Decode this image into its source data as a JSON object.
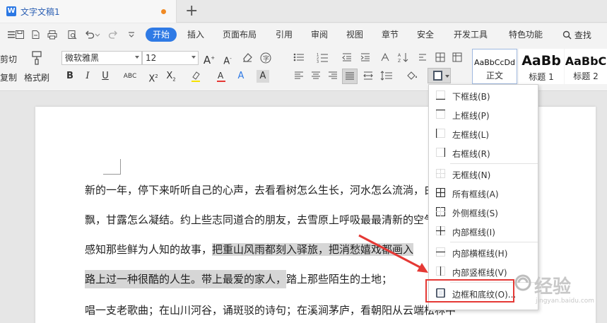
{
  "tab": {
    "title": "文字文稿1",
    "app_icon": "W"
  },
  "menu": {
    "start": "开始",
    "items": [
      "插入",
      "页面布局",
      "引用",
      "审阅",
      "视图",
      "章节",
      "安全",
      "开发工具",
      "特色功能"
    ],
    "search": "查找"
  },
  "ribbon": {
    "cut": "剪切",
    "copy": "复制",
    "format_painter": "格式刷",
    "font_name": "微软雅黑",
    "font_size": "12",
    "styles": [
      {
        "sample": "AaBbCcDd",
        "name": "正文"
      },
      {
        "sample": "AaBb",
        "name": "标题 1"
      },
      {
        "sample": "AaBbC",
        "name": "标题 2"
      }
    ]
  },
  "document": {
    "lines": [
      {
        "text": "新的一年，停下来听听自己的心声，去看看树怎么生长，河水怎么流淌，白云怎么飘"
      },
      {
        "text": "飘，甘露怎么凝结。约上些志同道合的朋友，去雪原上呼吸最最清新的空气，去"
      },
      {
        "text": "感知那些鲜为人知的故事，",
        "hl": "把重山风雨都刻入驿旅，把消愁嬉戏都画入"
      },
      {
        "hl": "路上过一种很酷的人生。带上最爱的家人，",
        "text": "踏上那些陌生的土地；"
      },
      {
        "text": "唱一支老歌曲；在山川河谷，诵斑驳的诗句；在溪涧茅庐，看朝阳从云端松林中"
      }
    ]
  },
  "dropdown": {
    "items": [
      {
        "label": "下框线(B)",
        "icon": "bottom-border-icon"
      },
      {
        "label": "上框线(P)",
        "icon": "top-border-icon"
      },
      {
        "label": "左框线(L)",
        "icon": "left-border-icon"
      },
      {
        "label": "右框线(R)",
        "icon": "right-border-icon"
      },
      {
        "label": "无框线(N)",
        "icon": "no-border-icon"
      },
      {
        "label": "所有框线(A)",
        "icon": "all-borders-icon"
      },
      {
        "label": "外侧框线(S)",
        "icon": "outside-borders-icon"
      },
      {
        "label": "内部框线(I)",
        "icon": "inside-borders-icon"
      },
      {
        "label": "内部横框线(H)",
        "icon": "inside-horizontal-border-icon"
      },
      {
        "label": "内部竖框线(V)",
        "icon": "inside-vertical-border-icon"
      },
      {
        "label": "边框和底纹(O)...",
        "icon": "borders-and-shading-icon"
      }
    ]
  },
  "colors": {
    "accent": "#2f7ae5",
    "highlight_box": "#e53935",
    "selection": "#d6d6d6"
  }
}
